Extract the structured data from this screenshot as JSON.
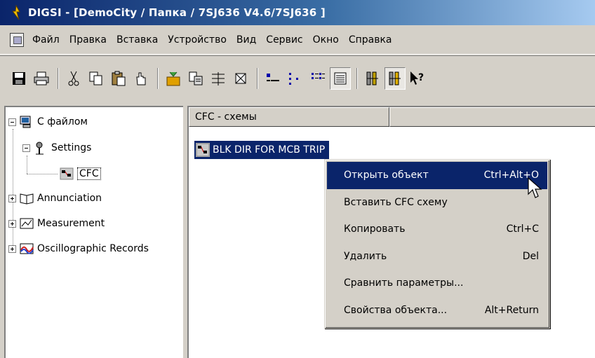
{
  "window": {
    "title": "DIGSI - [DemoCity / Папка / 7SJ636 V4.6/7SJ636 ]"
  },
  "menu": {
    "items": [
      "Файл",
      "Правка",
      "Вставка",
      "Устройство",
      "Вид",
      "Сервис",
      "Окно",
      "Справка"
    ]
  },
  "toolbar": {
    "icons": [
      "save-icon",
      "print-icon",
      "cut-icon",
      "copy-icon",
      "paste-icon",
      "hand-icon",
      "add-object-icon",
      "report-icon",
      "settings-icon",
      "device-icon",
      "large-icons-view-icon",
      "small-icons-view-icon",
      "list-view-icon",
      "details-view-icon",
      "device-open-icon",
      "device-online-icon",
      "help-pointer-icon"
    ]
  },
  "tree": {
    "root": "С файлом",
    "items": [
      {
        "label": "Settings",
        "expanded": true
      },
      {
        "label": "CFC"
      },
      {
        "label": "Annunciation"
      },
      {
        "label": "Measurement"
      },
      {
        "label": "Oscillographic Records"
      }
    ]
  },
  "list": {
    "column_header": "CFC - схемы",
    "items": [
      "BLK DIR FOR MCB TRIP"
    ]
  },
  "context_menu": {
    "items": [
      {
        "label": "Открыть объект",
        "shortcut": "Ctrl+Alt+O",
        "highlighted": true
      },
      {
        "label": "Вставить CFC схему",
        "shortcut": ""
      },
      {
        "label": "Копировать",
        "shortcut": "Ctrl+C"
      },
      {
        "label": "Удалить",
        "shortcut": "Del"
      },
      {
        "label": "Сравнить параметры...",
        "shortcut": ""
      },
      {
        "label": "Свойства объекта...",
        "shortcut": "Alt+Return"
      }
    ]
  },
  "colors": {
    "selection": "#0a246a",
    "face": "#d4d0c8"
  }
}
